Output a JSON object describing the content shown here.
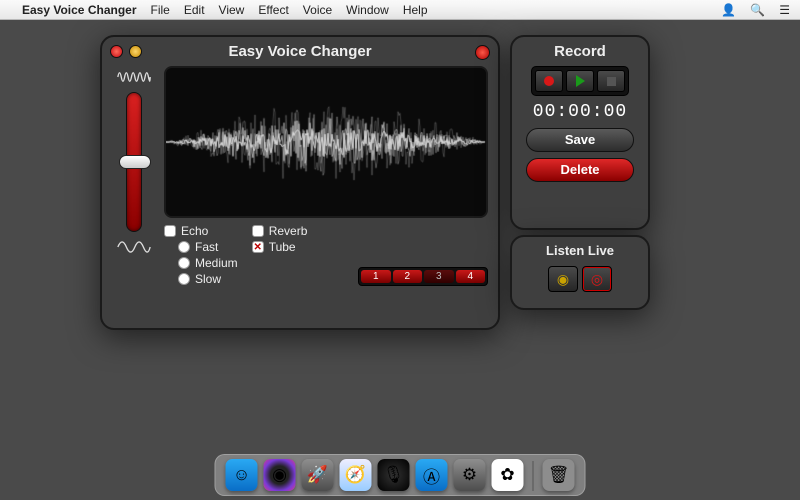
{
  "menubar": {
    "app_name": "Easy Voice Changer",
    "items": [
      "File",
      "Edit",
      "View",
      "Effect",
      "Voice",
      "Window",
      "Help"
    ]
  },
  "main": {
    "title": "Easy Voice Changer",
    "effects": {
      "echo": {
        "label": "Echo",
        "checked": false
      },
      "fast": {
        "label": "Fast",
        "checked": false
      },
      "medium": {
        "label": "Medium",
        "checked": false
      },
      "slow": {
        "label": "Slow",
        "checked": false
      },
      "reverb": {
        "label": "Reverb",
        "checked": false
      },
      "tube": {
        "label": "Tube",
        "checked": true
      }
    },
    "presets": [
      "1",
      "2",
      "3",
      "4"
    ],
    "active_preset": 3
  },
  "record": {
    "title": "Record",
    "timer": "00:00:00",
    "save_label": "Save",
    "delete_label": "Delete"
  },
  "listen": {
    "title": "Listen Live"
  },
  "dock": {
    "items": [
      {
        "name": "finder",
        "bg": "linear-gradient(#2aa9f3,#0a6ec7)",
        "glyph": "☺"
      },
      {
        "name": "siri",
        "bg": "radial-gradient(circle,#222 40%,#7a3bd8 70%,#d83b8a 100%)",
        "glyph": "◉"
      },
      {
        "name": "launchpad",
        "bg": "linear-gradient(#8e8e8e,#4d4d4d)",
        "glyph": "🚀"
      },
      {
        "name": "safari",
        "bg": "linear-gradient(#eef,#9cf)",
        "glyph": "🧭"
      },
      {
        "name": "easy-voice-changer",
        "bg": "radial-gradient(#333,#000)",
        "glyph": "🎙"
      },
      {
        "name": "app-store",
        "bg": "linear-gradient(#2aa9f3,#0a6ec7)",
        "glyph": "Ⓐ"
      },
      {
        "name": "system-preferences",
        "bg": "linear-gradient(#8e8e8e,#4d4d4d)",
        "glyph": "⚙"
      },
      {
        "name": "photos",
        "bg": "#fff",
        "glyph": "✿"
      }
    ],
    "trash": {
      "name": "trash",
      "bg": "rgba(255,255,255,0.1)",
      "glyph": "🗑"
    }
  }
}
